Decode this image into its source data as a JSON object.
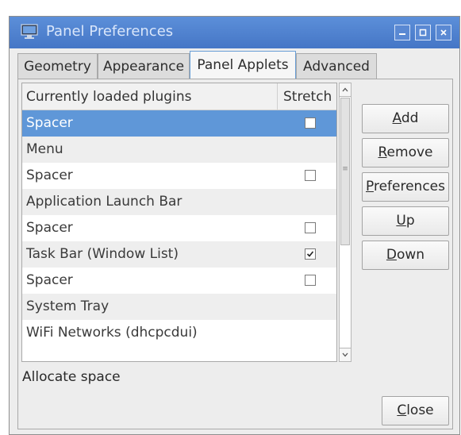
{
  "window": {
    "title": "Panel Preferences",
    "icon": "monitor-icon",
    "controls": [
      "minimize-icon",
      "maximize-icon",
      "close-icon"
    ]
  },
  "tabs": [
    {
      "label": "Geometry",
      "active": false
    },
    {
      "label": "Appearance",
      "active": false
    },
    {
      "label": "Panel Applets",
      "active": true
    },
    {
      "label": "Advanced",
      "active": false
    }
  ],
  "list": {
    "columns": {
      "name": "Currently loaded plugins",
      "stretch": "Stretch"
    },
    "rows": [
      {
        "label": "Spacer",
        "checkbox": true,
        "checked": false,
        "selected": true
      },
      {
        "label": "Menu",
        "checkbox": false,
        "checked": false,
        "selected": false
      },
      {
        "label": "Spacer",
        "checkbox": true,
        "checked": false,
        "selected": false
      },
      {
        "label": "Application Launch Bar",
        "checkbox": false,
        "checked": false,
        "selected": false
      },
      {
        "label": "Spacer",
        "checkbox": true,
        "checked": false,
        "selected": false
      },
      {
        "label": "Task Bar (Window List)",
        "checkbox": true,
        "checked": true,
        "selected": false
      },
      {
        "label": "Spacer",
        "checkbox": true,
        "checked": false,
        "selected": false
      },
      {
        "label": "System Tray",
        "checkbox": false,
        "checked": false,
        "selected": false
      },
      {
        "label": "WiFi Networks (dhcpcdui)",
        "checkbox": false,
        "checked": false,
        "selected": false
      }
    ]
  },
  "buttons": {
    "add": {
      "mnemonic": "A",
      "rest": "dd"
    },
    "remove": {
      "mnemonic": "R",
      "rest": "emove"
    },
    "preferences": {
      "mnemonic": "P",
      "rest": "references"
    },
    "up": {
      "mnemonic": "U",
      "rest": "p"
    },
    "down": {
      "mnemonic": "D",
      "rest": "own"
    },
    "close": {
      "mnemonic": "C",
      "rest": "lose"
    }
  },
  "status_text": "Allocate space",
  "colors": {
    "titlebar": "#4a7dcb",
    "selection": "#5f97d8"
  }
}
